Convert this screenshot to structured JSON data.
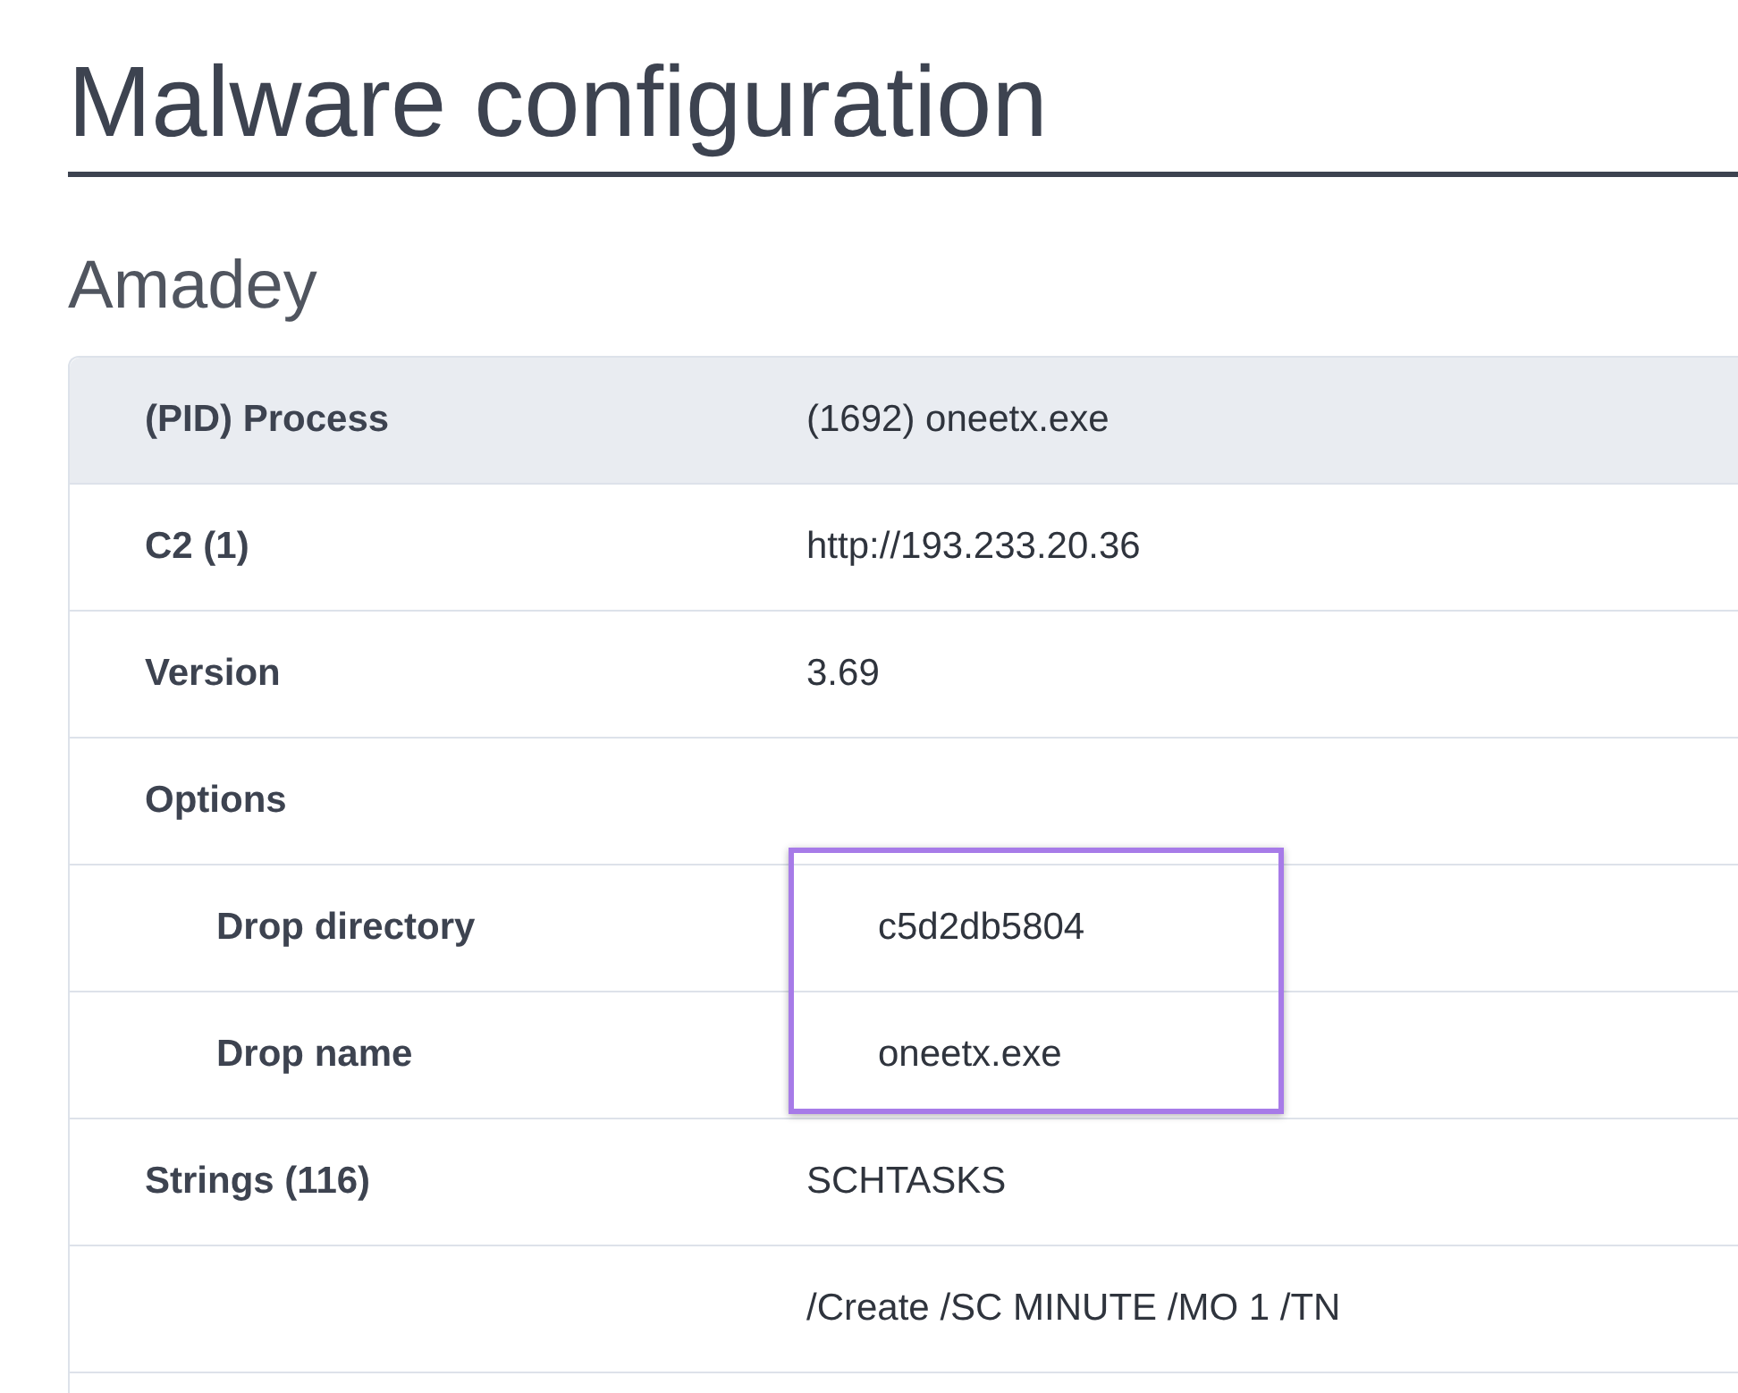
{
  "title": "Malware configuration",
  "family": "Amadey",
  "table": {
    "rows": [
      {
        "label": "(PID) Process",
        "value": "(1692) oneetx.exe",
        "header": true
      },
      {
        "label": "C2 (1)",
        "value": "http://193.233.20.36"
      },
      {
        "label": "Version",
        "value": "3.69"
      },
      {
        "label": "Options",
        "children": [
          {
            "label": "Drop directory",
            "value": "c5d2db5804",
            "highlighted": true
          },
          {
            "label": "Drop name",
            "value": "oneetx.exe",
            "highlighted": true
          }
        ]
      },
      {
        "label": "Strings (116)",
        "value": "SCHTASKS"
      },
      {
        "value": "/Create /SC MINUTE /MO 1 /TN"
      }
    ]
  }
}
